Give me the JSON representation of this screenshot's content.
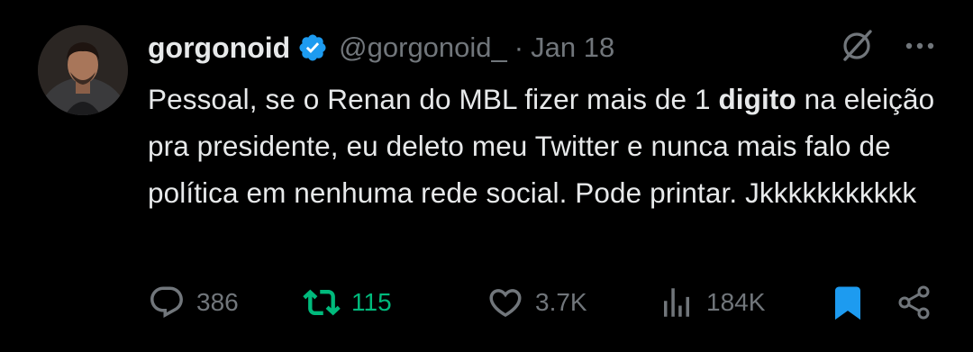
{
  "tweet": {
    "display_name": "gorgonoid",
    "handle": "@gorgonoid_",
    "separator": "·",
    "date": "Jan 18",
    "verified": true,
    "text_before_bold": "Pessoal, se o Renan do MBL fizer mais de 1 ",
    "text_bold": "digito",
    "text_after_bold": " na eleição pra presidente, eu deleto meu Twitter e nunca mais falo de política em nenhuma rede social. Pode printar. Jkkkkkkkkkkk"
  },
  "metrics": {
    "replies": "386",
    "retweets": "115",
    "likes": "3.7K",
    "views": "184K"
  },
  "state": {
    "retweeted": true,
    "bookmarked": true
  },
  "colors": {
    "background": "#000000",
    "text": "#e7e9ea",
    "muted": "#71767b",
    "verified_blue": "#1d9bf0",
    "retweet_green": "#00ba7c",
    "bookmark_blue": "#1d9bf0"
  },
  "icons": {
    "verified": "verified-badge-icon",
    "grok": "grok-icon",
    "more": "more-icon",
    "reply": "reply-icon",
    "retweet": "retweet-icon",
    "like": "heart-icon",
    "views": "views-icon",
    "bookmark": "bookmark-icon",
    "share": "share-icon"
  }
}
